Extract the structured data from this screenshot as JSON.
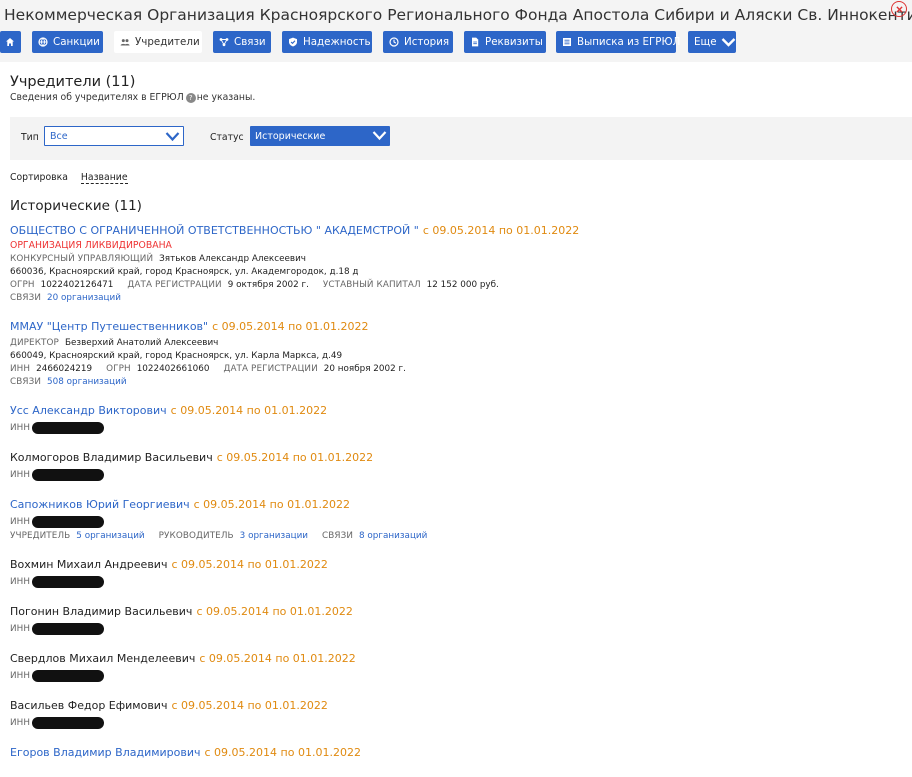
{
  "header": {
    "title": "Некоммерческая Организация Красноярского Регионального Фонда Апостола Сибири и Аляски Св. Иннокентия"
  },
  "tabs": [
    {
      "label": "",
      "icon": "home-icon"
    },
    {
      "label": "Санкции",
      "icon": "globe-icon"
    },
    {
      "label": "Учредители",
      "icon": "users-icon"
    },
    {
      "label": "Связи",
      "icon": "links-icon"
    },
    {
      "label": "Надежность",
      "icon": "shield-icon"
    },
    {
      "label": "История",
      "icon": "clock-icon"
    },
    {
      "label": "Реквизиты",
      "icon": "document-icon"
    },
    {
      "label": "Выписка из ЕГРЮЛ",
      "icon": "list-icon"
    },
    {
      "label": "Еще",
      "icon": "chevron-down-icon"
    }
  ],
  "founders": {
    "title": "Учредители (11)",
    "note_before": "Сведения об учредителях в ЕГРЮЛ",
    "note_after": "не указаны."
  },
  "filters": {
    "type_label": "Тип",
    "type_value": "Все",
    "status_label": "Статус",
    "status_value": "Исторические"
  },
  "sort": {
    "label": "Сортировка",
    "value": "Название"
  },
  "group": {
    "title": "Исторические (11)"
  },
  "entries": [
    {
      "name": "ОБЩЕСТВО С ОГРАНИЧЕННОЙ ОТВЕТСТВЕННОСТЬЮ \" АКАДЕМСТРОЙ \"",
      "period": "с 09.05.2014 по 01.01.2022",
      "status": "ОРГАНИЗАЦИЯ ЛИКВИДИРОВАНА",
      "role_label": "КОНКУРСНЫЙ УПРАВЛЯЮЩИЙ",
      "role_value": "Зятьков Александр Алексеевич",
      "address": "660036, Красноярский край, город Красноярск, ул. Академгородок, д.18 д",
      "ogrn_label": "ОГРН",
      "ogrn": "1022402126471",
      "reg_label": "ДАТА РЕГИСТРАЦИИ",
      "reg": "9 октября 2002 г.",
      "cap_label": "УСТАВНЫЙ КАПИТАЛ",
      "cap": "12 152 000 руб.",
      "links_label": "СВЯЗИ",
      "links": "20 организаций"
    },
    {
      "name": "ММАУ \"Центр Путешественников\"",
      "period": "с 09.05.2014 по 01.01.2022",
      "role_label": "ДИРЕКТОР",
      "role_value": "Безверхий Анатолий Алексеевич",
      "address": "660049, Красноярский край, город Красноярск, ул. Карла Маркса, д.49",
      "inn_label": "ИНН",
      "inn": "2466024219",
      "ogrn_label": "ОГРН",
      "ogrn": "1022402661060",
      "reg_label": "ДАТА РЕГИСТРАЦИИ",
      "reg": "20 ноября 2002 г.",
      "links_label": "СВЯЗИ",
      "links": "508 организаций"
    },
    {
      "name": "Усс Александр Викторович",
      "period": "с 09.05.2014 по 01.01.2022",
      "inn_label": "ИНН"
    },
    {
      "name": "Колмогоров Владимир Васильевич",
      "period": "с 09.05.2014 по 01.01.2022",
      "inn_label": "ИНН"
    },
    {
      "name": "Сапожников Юрий Георгиевич",
      "period": "с 09.05.2014 по 01.01.2022",
      "inn_label": "ИНН",
      "founder_label": "УЧРЕДИТЕЛЬ",
      "founder": "5 организаций",
      "head_label": "РУКОВОДИТЕЛЬ",
      "head": "3 организации",
      "links_label": "СВЯЗИ",
      "links": "8 организаций"
    },
    {
      "name": "Вохмин Михаил Андреевич",
      "period": "с 09.05.2014 по 01.01.2022",
      "inn_label": "ИНН"
    },
    {
      "name": "Погонин Владимир Васильевич",
      "period": "с 09.05.2014 по 01.01.2022",
      "inn_label": "ИНН"
    },
    {
      "name": "Свердлов Михаил Менделеевич",
      "period": "с 09.05.2014 по 01.01.2022",
      "inn_label": "ИНН"
    },
    {
      "name": "Васильев Федор Ефимович",
      "period": "с 09.05.2014 по 01.01.2022",
      "inn_label": "ИНН"
    },
    {
      "name": "Егоров Владимир Владимирович",
      "period": "с 09.05.2014 по 01.01.2022"
    }
  ]
}
